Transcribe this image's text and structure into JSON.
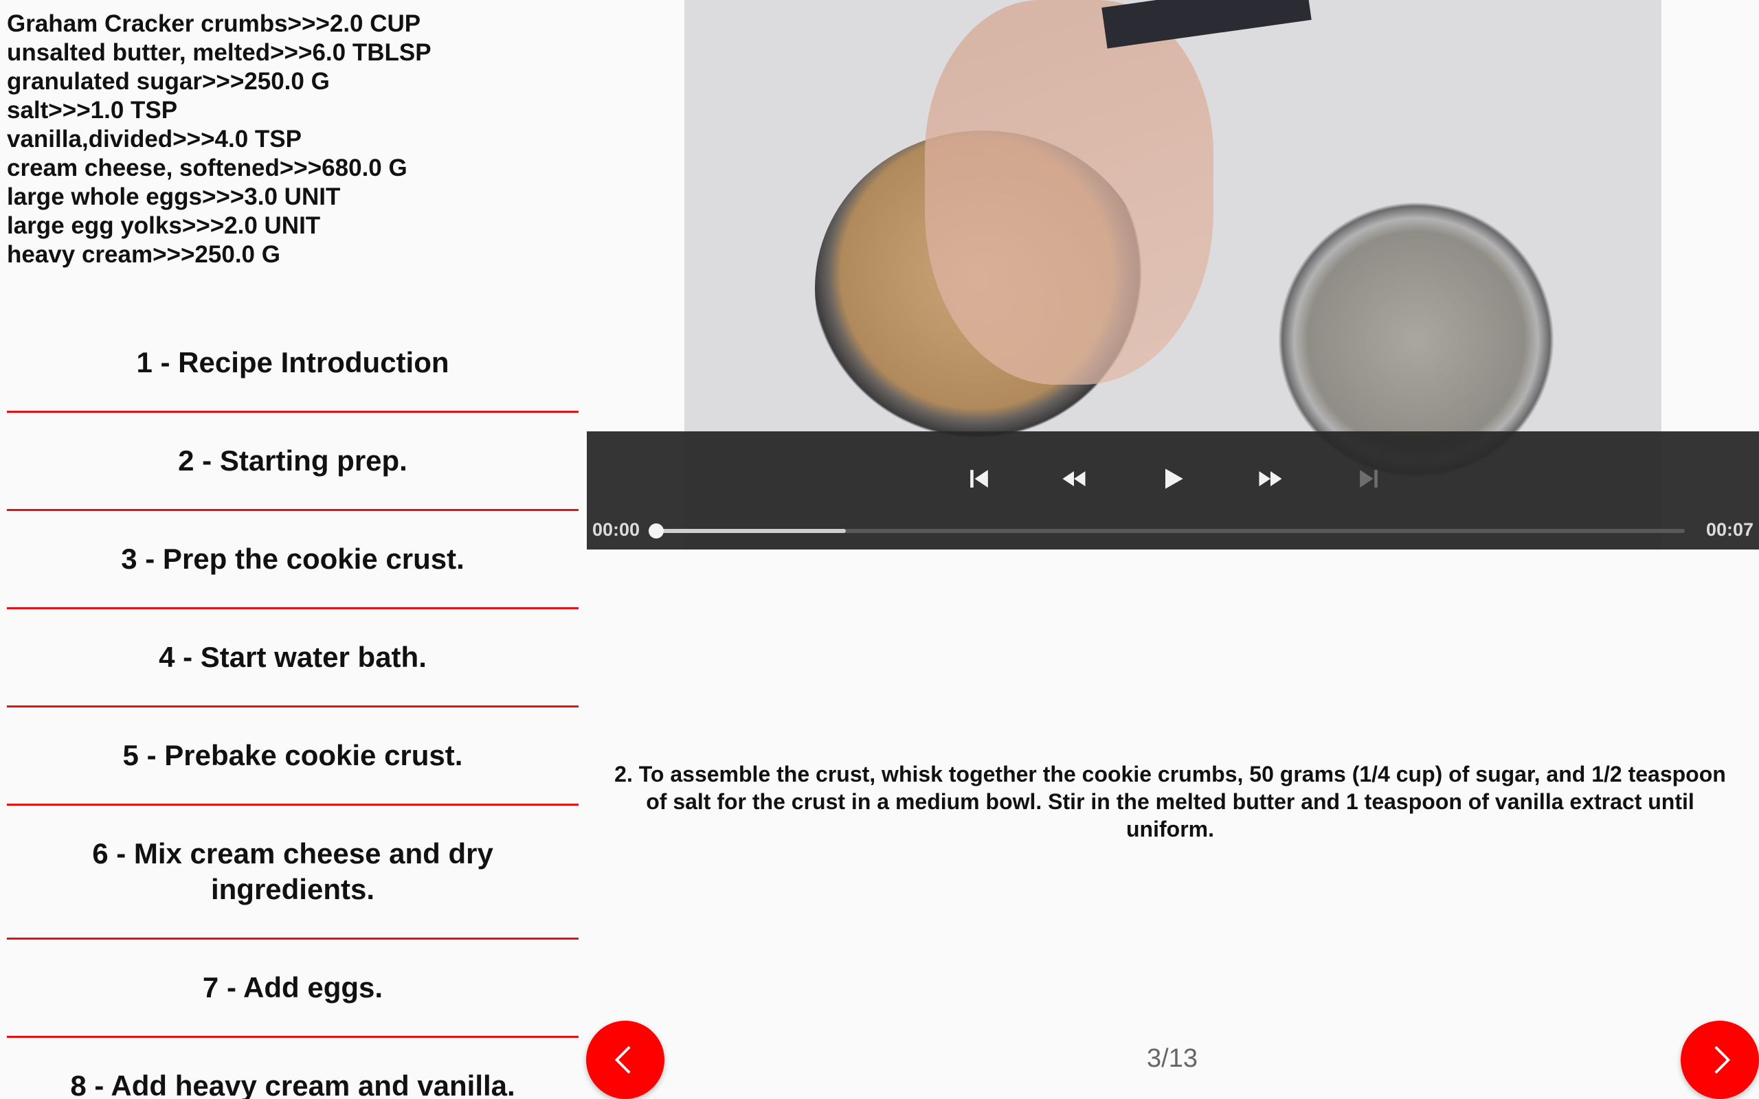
{
  "ingredients": [
    "Graham Cracker crumbs>>>2.0 CUP",
    "unsalted butter, melted>>>6.0 TBLSP",
    "granulated sugar>>>250.0 G",
    "salt>>>1.0 TSP",
    "vanilla,divided>>>4.0 TSP",
    "cream cheese, softened>>>680.0 G",
    "large whole eggs>>>3.0 UNIT",
    "large egg yolks>>>2.0 UNIT",
    "heavy cream>>>250.0 G"
  ],
  "steps": [
    "1 - Recipe Introduction",
    "2 - Starting prep.",
    "3 - Prep the cookie crust.",
    "4 - Start water bath.",
    "5 - Prebake cookie crust.",
    "6 - Mix cream cheese and dry ingredients.",
    "7 - Add eggs.",
    "8 - Add heavy cream and vanilla."
  ],
  "player": {
    "current_time": "00:00",
    "total_time": "00:07",
    "played_fraction": 0.0,
    "buffered_fraction": 0.185,
    "icons": [
      "skip-previous-icon",
      "rewind-icon",
      "play-icon",
      "fast-forward-icon",
      "skip-next-icon"
    ]
  },
  "description": "2. To assemble the crust, whisk together the cookie crumbs, 50 grams (1/4 cup) of sugar, and 1/2 teaspoon of salt for the crust in a medium bowl. Stir in the melted butter and 1 teaspoon of vanilla extract until uniform.",
  "pagination": {
    "indicator": "3/13"
  },
  "colors": {
    "accent": "#ff0000",
    "divider": "#e31212",
    "controls_bg": "#282828"
  },
  "nav": {
    "prev_icon": "chevron-left-icon",
    "next_icon": "chevron-right-icon"
  }
}
